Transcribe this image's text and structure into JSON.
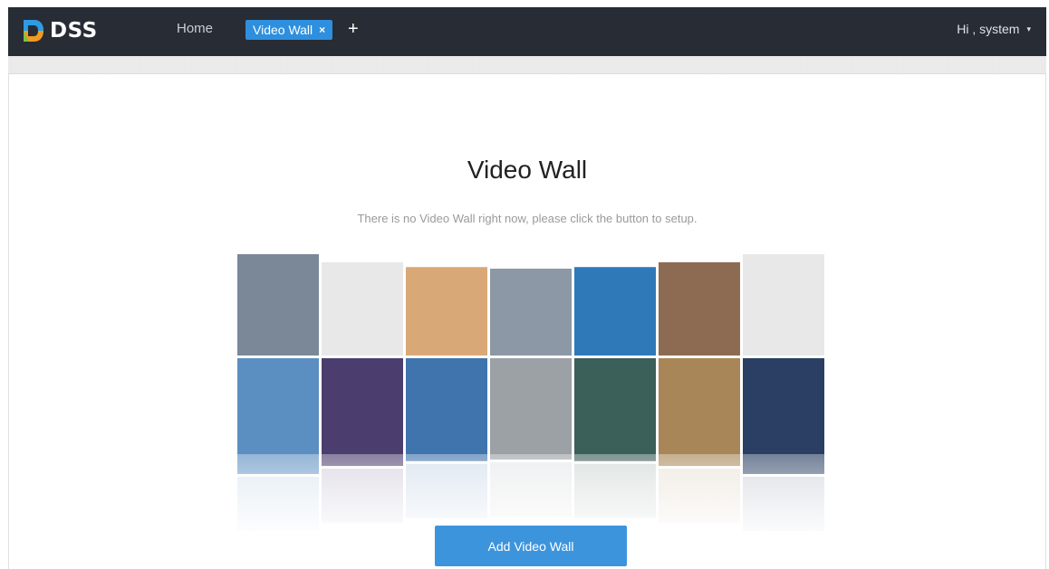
{
  "app": {
    "name": "DSS"
  },
  "nav": {
    "home": "Home"
  },
  "tab": {
    "label": "Video Wall",
    "close": "×",
    "add": "+"
  },
  "user": {
    "greeting": "Hi , system",
    "caret": "▾"
  },
  "main": {
    "title": "Video Wall",
    "message": "There is no Video Wall right now, please click the button to setup.",
    "button": "Add Video Wall"
  },
  "wall_tiles": [
    {
      "name": "airport-terminal",
      "color": "#7b8898"
    },
    {
      "name": "empty",
      "color": "#e8e8e8"
    },
    {
      "name": "snowy-road",
      "color": "#d9a877"
    },
    {
      "name": "bullet-train",
      "color": "#8c98a6"
    },
    {
      "name": "skyscraper",
      "color": "#2f79b8"
    },
    {
      "name": "child-photo",
      "color": "#8d6b52"
    },
    {
      "name": "empty",
      "color": "#e8e8e8"
    },
    {
      "name": "airplane-clouds",
      "color": "#5c8fc1"
    },
    {
      "name": "bridge-night",
      "color": "#4b3e6e"
    },
    {
      "name": "glass-tower",
      "color": "#3f74ad"
    },
    {
      "name": "curved-architecture",
      "color": "#9ca1a6"
    },
    {
      "name": "schoolgirl",
      "color": "#3b5f59"
    },
    {
      "name": "wheat-field",
      "color": "#a88657"
    },
    {
      "name": "police-officer",
      "color": "#2a3f63"
    }
  ]
}
